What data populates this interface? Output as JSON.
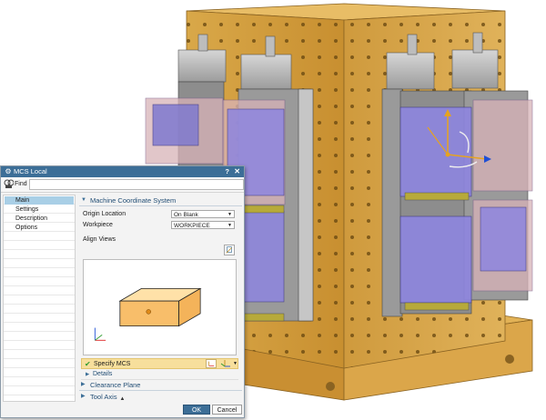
{
  "dialog": {
    "title": "MCS Local",
    "help": "?",
    "close": "✕",
    "find_label": "Find",
    "find_value": "",
    "nav": [
      "Main",
      "Settings",
      "Description",
      "Options"
    ],
    "sections": {
      "mcs": "Machine Coordinate System",
      "clearance": "Clearance Plane",
      "tool_axis": "Tool Axis"
    },
    "origin_location_label": "Origin Location",
    "origin_location_value": "On Blank",
    "workpiece_label": "Workpiece",
    "workpiece_value": "WORKPIECE",
    "align_views_label": "Align Views",
    "specify_mcs_label": "Specify MCS",
    "details_label": "Details",
    "ok_label": "OK",
    "cancel_label": "Cancel"
  },
  "colors": {
    "titlebar": "#3c6e97",
    "highlight_row": "#f7df9c",
    "nav_selected": "#a9cfe6",
    "fixture_frame": "#d8a548",
    "workpiece_purple": "#8e86e0"
  },
  "icons": [
    "find-icon",
    "close-icon",
    "help-icon",
    "align-views-icon",
    "csys-dialog-icon",
    "csys-inferred-icon",
    "check-icon",
    "collapse-triangle-icon",
    "expand-triangle-icon"
  ]
}
